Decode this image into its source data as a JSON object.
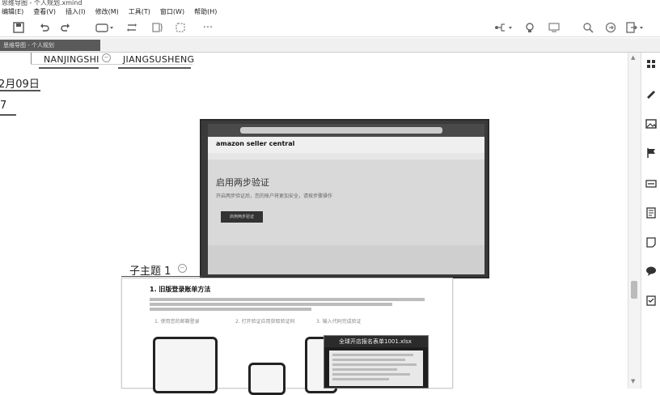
{
  "window": {
    "title": "思维导图 - 个人规划.xmind"
  },
  "menu": {
    "items": [
      "编辑(E)",
      "查看(V)",
      "插入(I)",
      "修改(M)",
      "工具(T)",
      "窗口(W)",
      "帮助(H)"
    ]
  },
  "toolbar": {
    "icons": [
      "save-icon",
      "undo-icon",
      "redo-icon",
      "insert-topic-icon",
      "relationship-icon",
      "summary-icon",
      "boundary-icon",
      "more-icon",
      "mindmap-structure-icon",
      "idea-icon",
      "presentation-icon",
      "search-icon",
      "share-icon",
      "export-icon"
    ],
    "more_label": "···"
  },
  "doc_tab": {
    "label": "思维导图 - 个人规划"
  },
  "mindmap": {
    "node_nanjing": "NANJINGSHI",
    "node_jiangsu": "JIANGSUSHENG",
    "node_date": "2月09日",
    "node_7": "7",
    "subtopic": "子主题 1"
  },
  "embedded_screenshot": {
    "logo": "amazon seller central",
    "title": "启用两步验证",
    "subtitle": "开启两步验证后，您的账户将更加安全，请按步骤操作",
    "button": "启用两步验证"
  },
  "embedded_doc": {
    "heading": "1. 旧版登录账单方法",
    "col1": "1. 使用您的邮箱登录",
    "col2": "2. 打开验证应用获取验证码",
    "col3": "3. 输入代码完成验证"
  },
  "popup": {
    "title": "全球开店报名表单1001.xlsx"
  },
  "right_panel": {
    "icons": [
      "format-icon",
      "marker-icon",
      "image-icon",
      "flag-icon",
      "label-icon",
      "outline-icon",
      "notes-icon",
      "comments-icon",
      "task-icon"
    ]
  },
  "colors": {
    "accent": "#3a76c4",
    "tab_bg": "#5a5a5a"
  }
}
